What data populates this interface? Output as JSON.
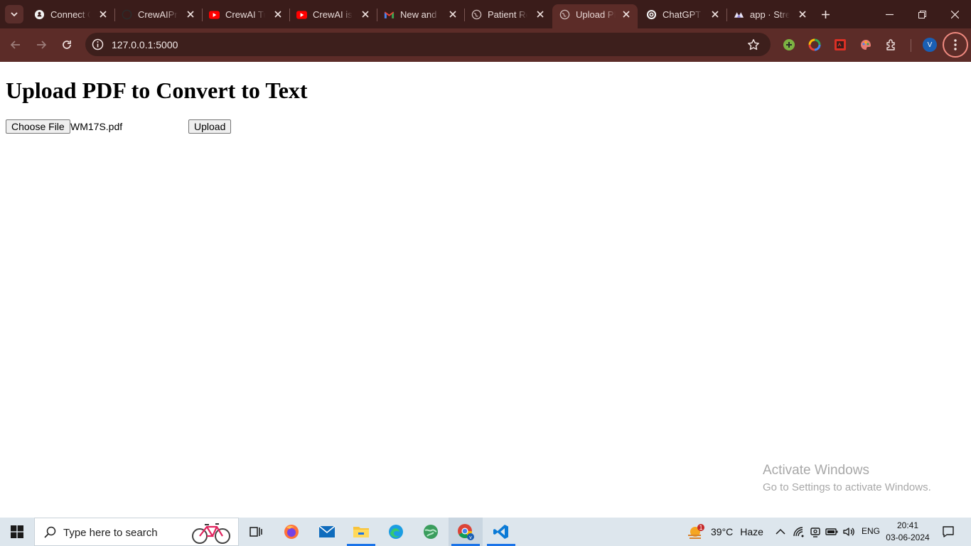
{
  "browser": {
    "tabs": [
      {
        "title": "Connect C",
        "icon": "github-logo-icon"
      },
      {
        "title": "CrewAIPro",
        "icon": "github-logo-icon"
      },
      {
        "title": "CrewAI Tu",
        "icon": "youtube-icon"
      },
      {
        "title": "CrewAI is",
        "icon": "youtube-icon"
      },
      {
        "title": "New and",
        "icon": "gmail-icon"
      },
      {
        "title": "Patient Re",
        "icon": "globe-icon"
      },
      {
        "title": "Upload PI",
        "icon": "globe-icon",
        "active": true
      },
      {
        "title": "ChatGPT",
        "icon": "chatgpt-icon"
      },
      {
        "title": "app · Strea",
        "icon": "streamlit-icon"
      }
    ],
    "url": "127.0.0.1:5000",
    "profile_initial": "V"
  },
  "page": {
    "heading": "Upload PDF to Convert to Text",
    "choose_file_label": "Choose File",
    "selected_file": "WM17S.pdf",
    "upload_label": "Upload"
  },
  "watermark": {
    "line1": "Activate Windows",
    "line2": "Go to Settings to activate Windows."
  },
  "taskbar": {
    "search_placeholder": "Type here to search",
    "weather_badge": "1",
    "weather_temp": "39°C",
    "weather_desc": "Haze",
    "language": "ENG",
    "time": "20:41",
    "date": "03-06-2024"
  },
  "colors": {
    "tabstrip": "#3a1c1a",
    "toolbar": "#5c2c28",
    "omnibox": "#3d1f1c",
    "taskbar": "#dde6ed",
    "menu_ring": "#f08a80"
  }
}
